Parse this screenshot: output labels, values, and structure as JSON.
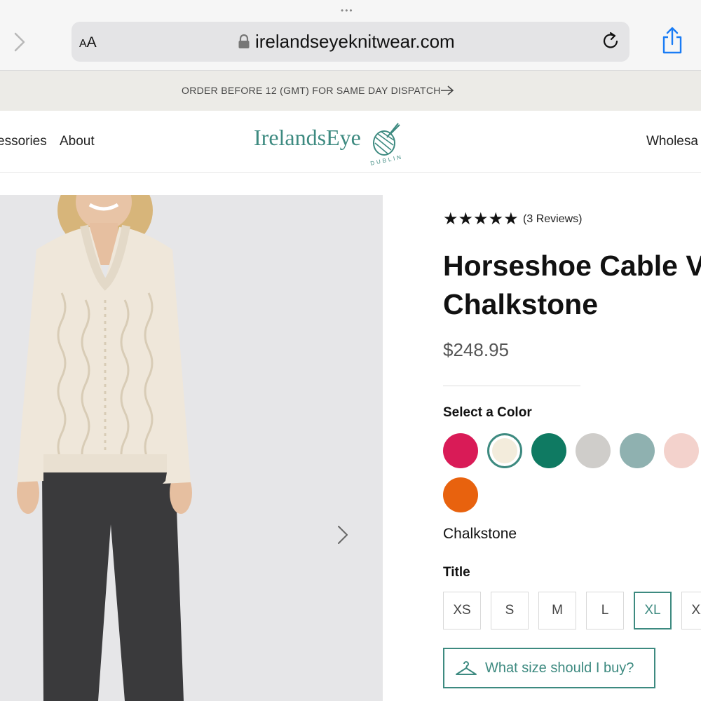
{
  "browser": {
    "aa_label_small": "A",
    "aa_label_large": "A",
    "url": "irelandseyeknitwear.com"
  },
  "announcement": {
    "text": "ORDER BEFORE 12 (GMT) FOR SAME DAY DISPATCH"
  },
  "nav": {
    "left_items": [
      "essories",
      "About"
    ],
    "logo_text": "IrelandsEye",
    "logo_sub": "DUBLIN",
    "right_item": "Wholesa"
  },
  "product": {
    "rating_stars": 5,
    "reviews": "(3 Reviews)",
    "title_line1": "Horseshoe Cable V",
    "title_line2": "Chalkstone",
    "price": "$248.95",
    "color_label": "Select a Color",
    "colors": [
      {
        "hex": "#d91b57"
      },
      {
        "hex": "#f3ecdc"
      },
      {
        "hex": "#0f7a62"
      },
      {
        "hex": "#cfcdca"
      },
      {
        "hex": "#8fb1b0"
      },
      {
        "hex": "#f3d2cc"
      },
      {
        "hex": "#e8620e"
      }
    ],
    "selected_color_name": "Chalkstone",
    "size_label": "Title",
    "sizes": [
      "XS",
      "S",
      "M",
      "L",
      "XL",
      "XX"
    ],
    "selected_size": "XL",
    "size_help": "What size should I buy?"
  },
  "colors_ui": {
    "accent": "#3d8a80",
    "announcement_bg": "#ecebe7"
  }
}
